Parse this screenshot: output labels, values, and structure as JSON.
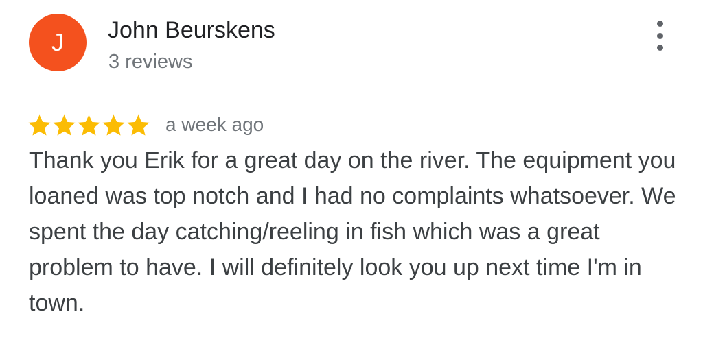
{
  "reviewer": {
    "avatar_initial": "J",
    "avatar_color": "#f4511e",
    "name": "John Beurskens",
    "review_count": "3 reviews"
  },
  "menu": {
    "icon": "more-vert-icon"
  },
  "review": {
    "rating": 5,
    "max_rating": 5,
    "star_color": "#fbbc04",
    "date": "a week ago",
    "text": "Thank you Erik for a great day on the river. The equipment you loaned was top notch and I had no complaints whatsoever. We spent the day catching/reeling in fish which was a great problem to have. I will definitely look you up next time I'm in town."
  }
}
